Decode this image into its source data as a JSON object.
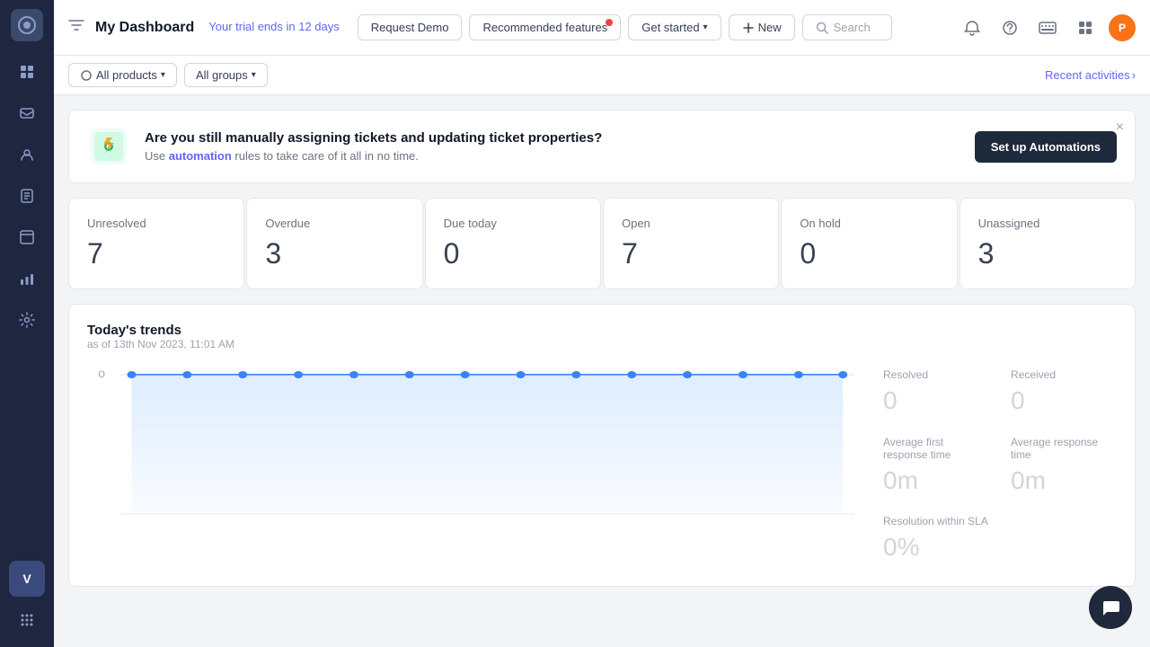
{
  "app": {
    "logo_char": "⊙"
  },
  "sidebar": {
    "items": [
      {
        "id": "dashboard",
        "icon": "⊙",
        "active": true
      },
      {
        "id": "inbox",
        "icon": "✉"
      },
      {
        "id": "contacts",
        "icon": "👤"
      },
      {
        "id": "kb",
        "icon": "📖"
      },
      {
        "id": "tickets",
        "icon": "🎫"
      },
      {
        "id": "reports",
        "icon": "📊"
      },
      {
        "id": "settings",
        "icon": "⚙"
      }
    ],
    "bottom": {
      "grid_icon": "⠿",
      "avatar_char": "V"
    }
  },
  "navbar": {
    "filter_icon": "⚡",
    "title": "My Dashboard",
    "trial_text": "Your trial ends in 12 days",
    "request_demo_label": "Request Demo",
    "recommended_label": "Recommended features",
    "get_started_label": "Get started",
    "new_label": "New",
    "search_placeholder": "Search",
    "bell_icon": "🔔",
    "help_icon": "?",
    "keyboard_icon": "⌨",
    "apps_icon": "⊞",
    "avatar_char": "P"
  },
  "sub_navbar": {
    "all_products_label": "All products",
    "all_groups_label": "All groups",
    "recent_activities_label": "Recent activities"
  },
  "banner": {
    "title": "Are you still manually assigning tickets and updating ticket properties?",
    "description_prefix": "Use ",
    "description_highlight": "automation",
    "description_suffix": " rules to take care of it all in no time.",
    "button_label": "Set up Automations",
    "close_icon": "×"
  },
  "stats": [
    {
      "label": "Unresolved",
      "value": "7"
    },
    {
      "label": "Overdue",
      "value": "3"
    },
    {
      "label": "Due today",
      "value": "0"
    },
    {
      "label": "Open",
      "value": "7"
    },
    {
      "label": "On hold",
      "value": "0"
    },
    {
      "label": "Unassigned",
      "value": "3"
    }
  ],
  "trends": {
    "title": "Today's trends",
    "subtitle": "as of 13th Nov 2023, 11:01 AM",
    "stats": [
      {
        "label": "Resolved",
        "value": "0",
        "unit": ""
      },
      {
        "label": "Received",
        "value": "0",
        "unit": ""
      },
      {
        "label": "Average first response time",
        "value": "0m",
        "unit": ""
      },
      {
        "label": "Average response time",
        "value": "0m",
        "unit": ""
      },
      {
        "label": "Resolution within SLA",
        "value": "0%",
        "unit": ""
      }
    ],
    "chart_y_label": "0",
    "chart_color": "#93c5fd",
    "chart_line_color": "#3b82f6"
  }
}
